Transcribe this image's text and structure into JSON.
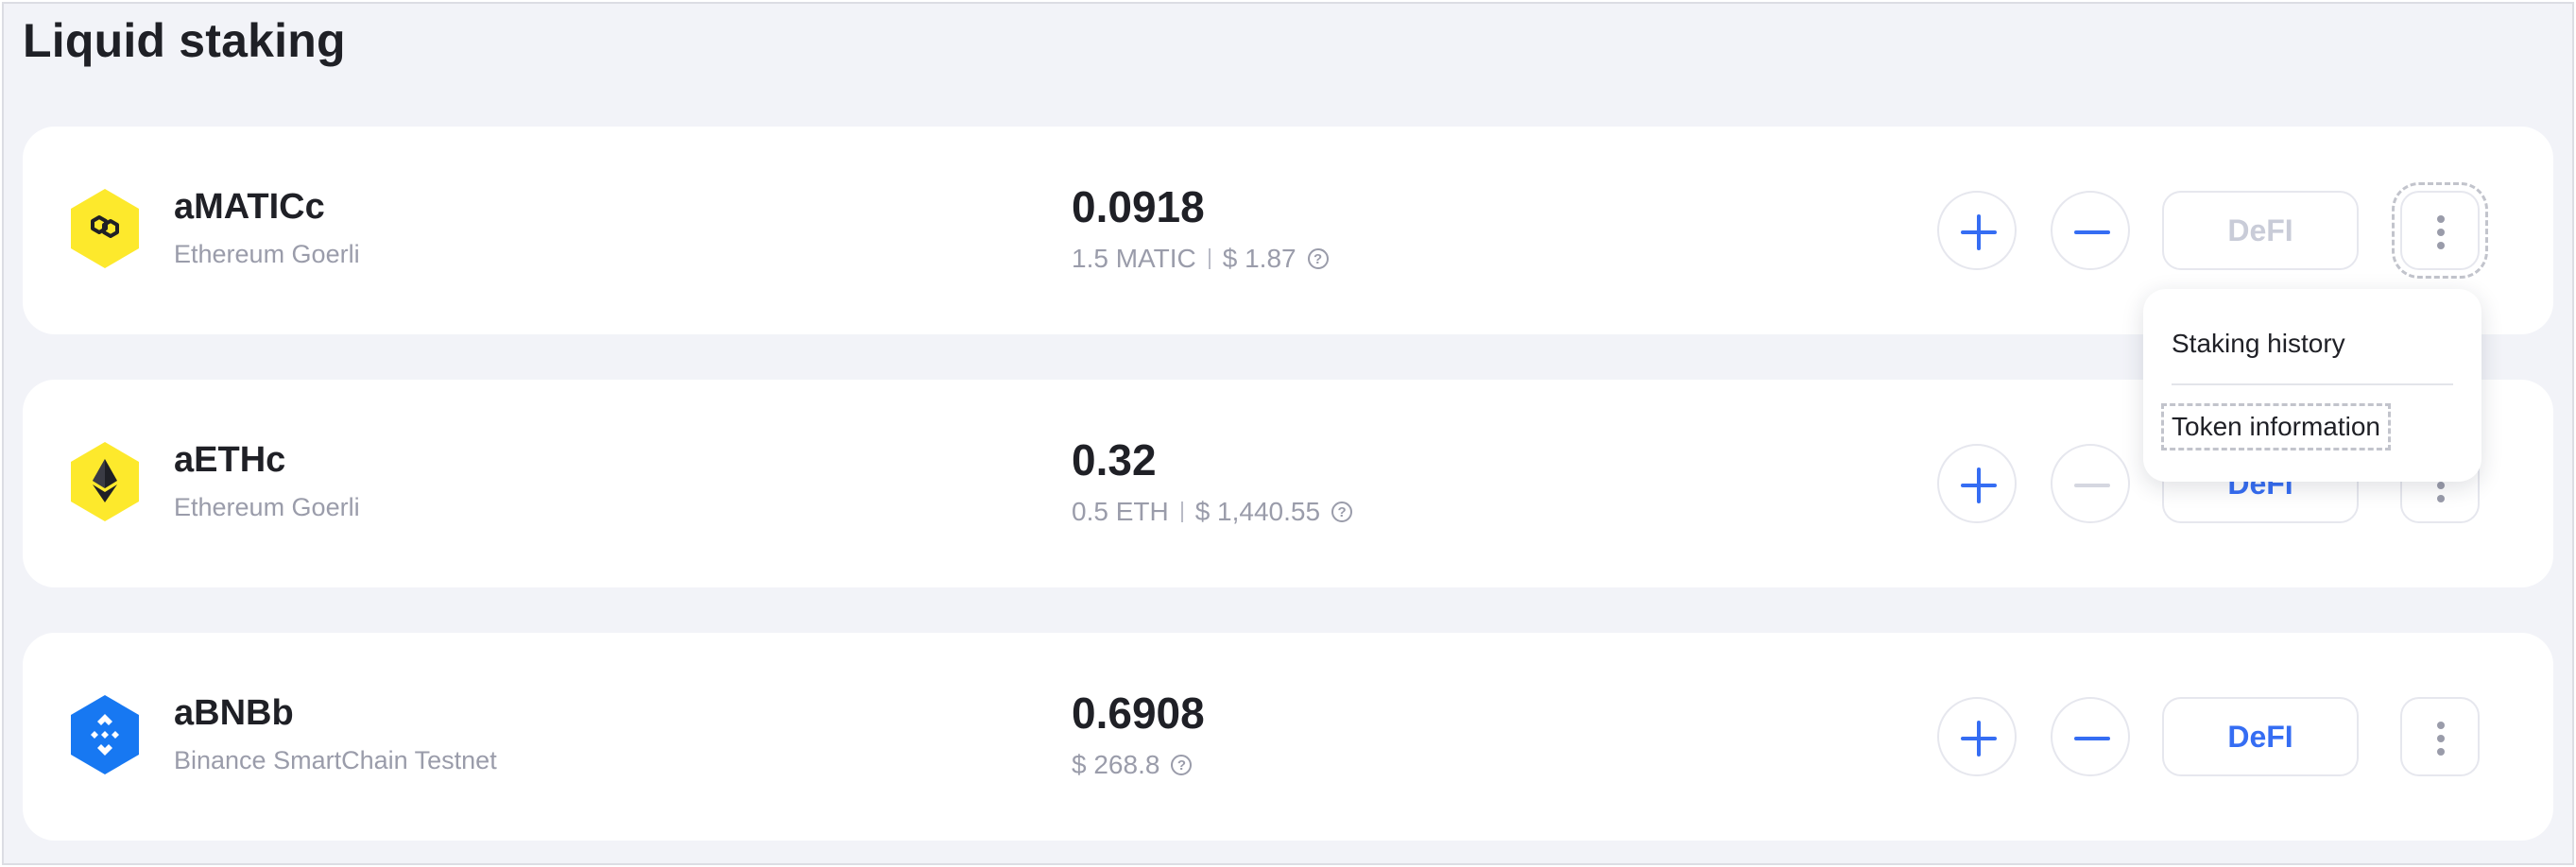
{
  "page_title": "Liquid staking",
  "colors": {
    "accent": "#356df3",
    "matic_icon_bg": "#fde92c",
    "eth_icon_bg": "#fde92c",
    "bnb_icon_bg": "#1778f2"
  },
  "tokens": [
    {
      "name": "aMATICc",
      "network": "Ethereum Goerli",
      "amount": "0.0918",
      "sub_native": "1.5 MATIC",
      "sub_usd": "$ 1.87",
      "icon": "polygon-icon",
      "defi_label": "DeFI",
      "defi_enabled": false
    },
    {
      "name": "aETHc",
      "network": "Ethereum Goerli",
      "amount": "0.32",
      "sub_native": "0.5 ETH",
      "sub_usd": "$ 1,440.55",
      "icon": "ethereum-icon",
      "defi_label": "DeFI",
      "defi_enabled": true
    },
    {
      "name": "aBNBb",
      "network": "Binance SmartChain Testnet",
      "amount": "0.6908",
      "sub_native": "",
      "sub_usd": "$ 268.8",
      "icon": "binance-icon",
      "defi_label": "DeFI",
      "defi_enabled": true
    }
  ],
  "menu": {
    "items": [
      "Staking history",
      "Token information"
    ]
  },
  "help_glyph": "?"
}
